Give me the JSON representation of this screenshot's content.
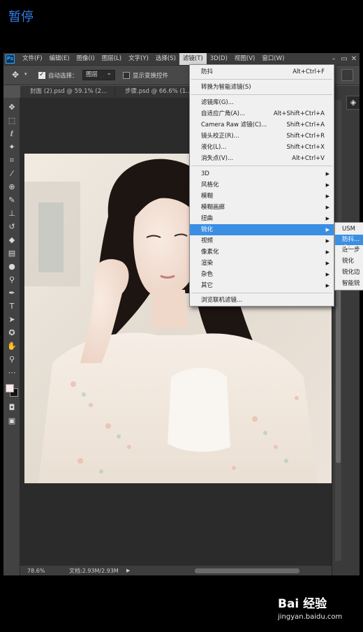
{
  "overlay": {
    "pause_label": "暂停"
  },
  "app": {
    "logo_text": "Ps"
  },
  "menubar": {
    "items": [
      {
        "label": "文件(F)"
      },
      {
        "label": "编辑(E)"
      },
      {
        "label": "图像(I)"
      },
      {
        "label": "图层(L)"
      },
      {
        "label": "文字(Y)"
      },
      {
        "label": "选择(S)"
      },
      {
        "label": "滤镜(T)"
      },
      {
        "label": "3D(D)"
      },
      {
        "label": "视图(V)"
      },
      {
        "label": "窗口(W)"
      }
    ],
    "active_item": "滤镜(T)"
  },
  "options_bar": {
    "auto_select_label": "自动选择：",
    "auto_select_checked": true,
    "auto_select_target": "图层",
    "show_transform_label": "显示变换控件",
    "show_transform_checked": false
  },
  "tabs": [
    {
      "label": "封面 (2).psd @ 59.1% (2..."
    },
    {
      "label": "步骤.psd @ 66.6% (1..."
    }
  ],
  "filter_menu": {
    "items": [
      {
        "label": "防抖",
        "shortcut": "Alt+Ctrl+F"
      },
      {
        "label": "转换为智能滤镜(S)",
        "shortcut": ""
      },
      {
        "label": "滤镜库(G)...",
        "shortcut": ""
      },
      {
        "label": "自适应广角(A)...",
        "shortcut": "Alt+Shift+Ctrl+A"
      },
      {
        "label": "Camera Raw 滤镜(C)...",
        "shortcut": "Shift+Ctrl+A"
      },
      {
        "label": "镜头校正(R)...",
        "shortcut": "Shift+Ctrl+R"
      },
      {
        "label": "液化(L)...",
        "shortcut": "Shift+Ctrl+X"
      },
      {
        "label": "消失点(V)...",
        "shortcut": "Alt+Ctrl+V"
      },
      {
        "label": "3D",
        "submenu": true
      },
      {
        "label": "风格化",
        "submenu": true
      },
      {
        "label": "模糊",
        "submenu": true
      },
      {
        "label": "模糊画廊",
        "submenu": true
      },
      {
        "label": "扭曲",
        "submenu": true
      },
      {
        "label": "锐化",
        "submenu": true
      },
      {
        "label": "视频",
        "submenu": true
      },
      {
        "label": "像素化",
        "submenu": true
      },
      {
        "label": "渲染",
        "submenu": true
      },
      {
        "label": "杂色",
        "submenu": true
      },
      {
        "label": "其它",
        "submenu": true
      },
      {
        "label": "浏览联机滤镜..."
      }
    ],
    "highlighted": "锐化"
  },
  "sharpen_submenu": {
    "items": [
      {
        "label": "USM"
      },
      {
        "label": "防抖..."
      },
      {
        "label": "进一步"
      },
      {
        "label": "锐化"
      },
      {
        "label": "锐化边"
      },
      {
        "label": "智能锐"
      }
    ],
    "highlighted": "防抖..."
  },
  "status": {
    "zoom": "78.6%",
    "doc_size": "文档:2.93M/2.93M"
  },
  "watermark": {
    "logo": "Bai 经验",
    "url": "jingyan.baidu.com"
  }
}
